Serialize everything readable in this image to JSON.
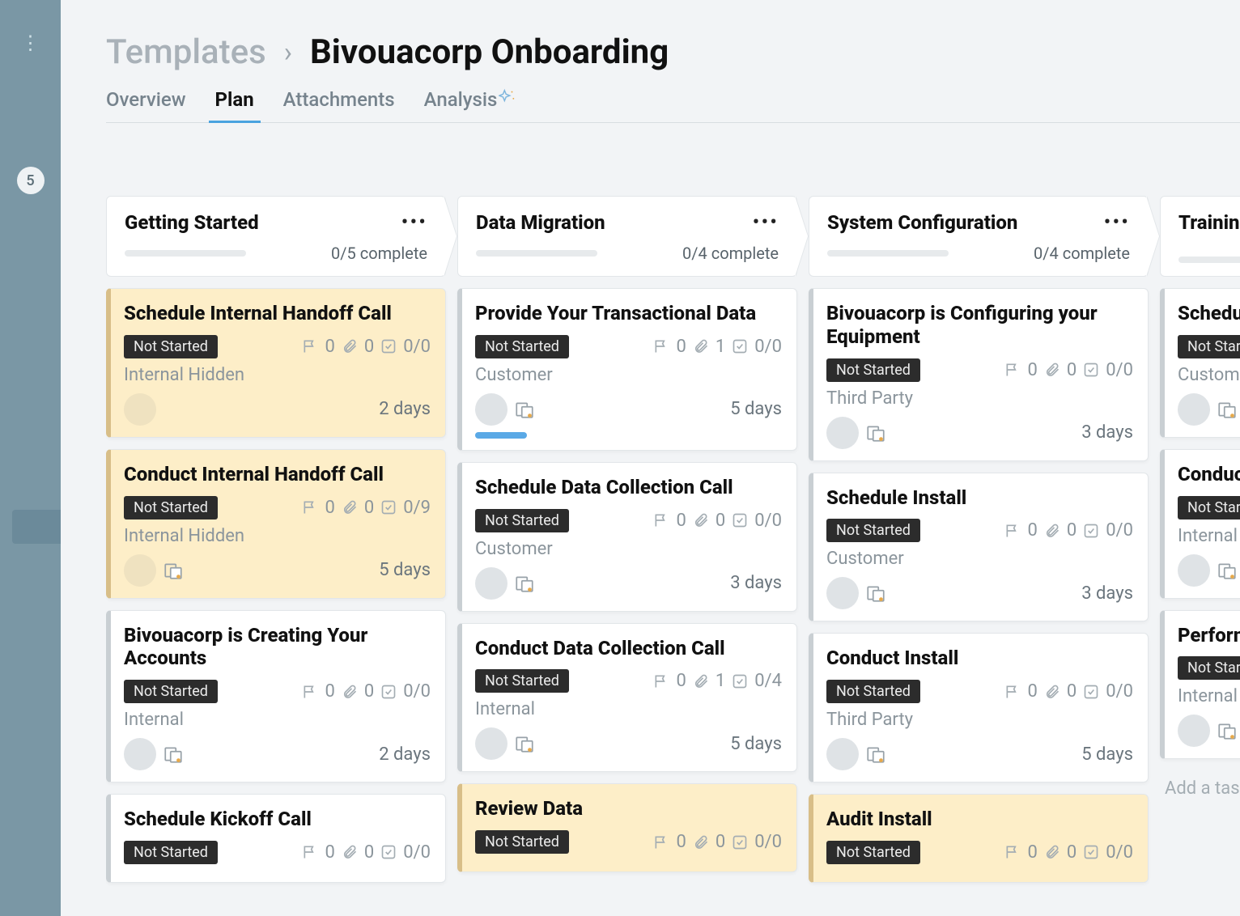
{
  "sidebar": {
    "badge": "5"
  },
  "breadcrumb": {
    "templates": "Templates",
    "title": "Bivouacorp Onboarding"
  },
  "tabs": [
    {
      "label": "Overview",
      "active": false
    },
    {
      "label": "Plan",
      "active": true
    },
    {
      "label": "Attachments",
      "active": false
    },
    {
      "label": "Analysis",
      "active": false,
      "sparkle": true
    }
  ],
  "add_task_placeholder": "Add a task....",
  "stages": [
    {
      "title": "Getting Started",
      "progress": "0/5 complete",
      "cards": [
        {
          "title": "Schedule Internal Handoff Call",
          "status": "Not Started",
          "flag": "0",
          "clip": "0",
          "check": "0/0",
          "sub": "Internal Hidden",
          "duration": "2 days",
          "highlight": true,
          "overlay": false
        },
        {
          "title": "Conduct Internal Handoff Call",
          "status": "Not Started",
          "flag": "0",
          "clip": "0",
          "check": "0/9",
          "sub": "Internal Hidden",
          "duration": "5 days",
          "highlight": true,
          "overlay": true
        },
        {
          "title": "Bivouacorp is Creating Your Accounts",
          "status": "Not Started",
          "flag": "0",
          "clip": "0",
          "check": "0/0",
          "sub": "Internal",
          "duration": "2 days",
          "highlight": false,
          "overlay": true
        },
        {
          "title": "Schedule Kickoff Call",
          "status": "Not Started",
          "flag": "0",
          "clip": "0",
          "check": "0/0",
          "sub": "",
          "duration": "",
          "highlight": false,
          "overlay": false,
          "truncated": true
        }
      ]
    },
    {
      "title": "Data Migration",
      "progress": "0/4 complete",
      "cards": [
        {
          "title": "Provide Your Transactional Data",
          "status": "Not Started",
          "flag": "0",
          "clip": "1",
          "check": "0/0",
          "sub": "Customer",
          "duration": "5 days",
          "highlight": false,
          "overlay": true,
          "bluebar": true
        },
        {
          "title": "Schedule Data Collection Call",
          "status": "Not Started",
          "flag": "0",
          "clip": "0",
          "check": "0/0",
          "sub": "Customer",
          "duration": "3 days",
          "highlight": false,
          "overlay": true
        },
        {
          "title": "Conduct Data Collection Call",
          "status": "Not Started",
          "flag": "0",
          "clip": "1",
          "check": "0/4",
          "sub": "Internal",
          "duration": "5 days",
          "highlight": false,
          "overlay": true
        },
        {
          "title": "Review Data",
          "status": "Not Started",
          "flag": "0",
          "clip": "0",
          "check": "0/0",
          "sub": "",
          "duration": "",
          "highlight": true,
          "overlay": false,
          "truncated": true
        }
      ]
    },
    {
      "title": "System Configuration",
      "progress": "0/4 complete",
      "cards": [
        {
          "title": "Bivouacorp is Configuring your Equipment",
          "status": "Not Started",
          "flag": "0",
          "clip": "0",
          "check": "0/0",
          "sub": "Third Party",
          "duration": "3 days",
          "highlight": false,
          "overlay": true
        },
        {
          "title": "Schedule Install",
          "status": "Not Started",
          "flag": "0",
          "clip": "0",
          "check": "0/0",
          "sub": "Customer",
          "duration": "3 days",
          "highlight": false,
          "overlay": true
        },
        {
          "title": "Conduct Install",
          "status": "Not Started",
          "flag": "0",
          "clip": "0",
          "check": "0/0",
          "sub": "Third Party",
          "duration": "5 days",
          "highlight": false,
          "overlay": true
        },
        {
          "title": "Audit Install",
          "status": "Not Started",
          "flag": "0",
          "clip": "0",
          "check": "0/0",
          "sub": "",
          "duration": "",
          "highlight": true,
          "overlay": false,
          "truncated": true
        }
      ]
    },
    {
      "title": "Training",
      "progress": "",
      "cards": [
        {
          "title": "Schedule Tra",
          "status": "Not Started",
          "flag": "",
          "clip": "",
          "check": "",
          "sub": "Customer",
          "duration": "",
          "highlight": false,
          "overlay": true
        },
        {
          "title": "Conduct Tra",
          "status": "Not Started",
          "flag": "",
          "clip": "",
          "check": "",
          "sub": "Internal",
          "duration": "",
          "highlight": false,
          "overlay": true
        },
        {
          "title": "Perform Dry",
          "status": "Not Started",
          "flag": "",
          "clip": "",
          "check": "",
          "sub": "Internal",
          "duration": "",
          "highlight": false,
          "overlay": true
        }
      ],
      "addTask": true
    }
  ]
}
